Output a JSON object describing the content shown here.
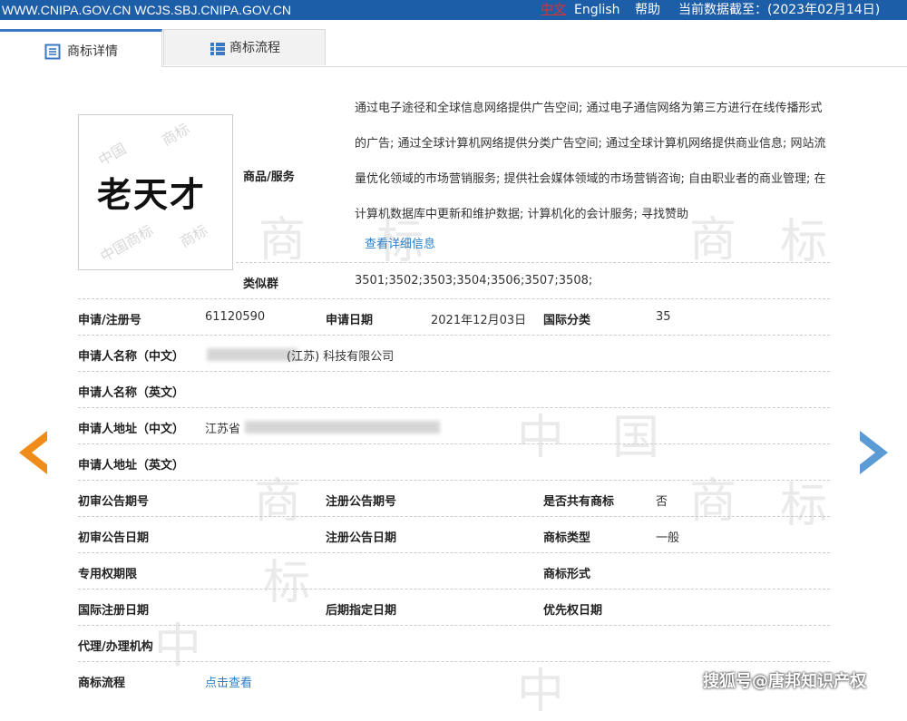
{
  "topbar": {
    "sites": "WWW.CNIPA.GOV.CN WCJS.SBJ.CNIPA.GOV.CN",
    "lang_cn": "中文",
    "lang_en": "English",
    "help": "帮助",
    "data_date": "当前数据截至：(2023年02月14日)"
  },
  "tabs": [
    {
      "label": "商标详情",
      "icon": "document-list-icon",
      "active": true
    },
    {
      "label": "商标流程",
      "icon": "flow-list-icon",
      "active": false
    }
  ],
  "trademark": {
    "logo_text": "老天才",
    "goods_label": "商品/服务",
    "goods_text": "通过电子途径和全球信息网络提供广告空间; 通过电子通信网络为第三方进行在线传播形式的广告; 通过全球计算机网络提供分类广告空间; 通过全球计算机网络提供商业信息; 网站流量优化领域的市场营销服务; 提供社会媒体领域的市场营销咨询; 自由职业者的商业管理; 在计算机数据库中更新和维护数据; 计算机化的会计服务; 寻找赞助",
    "view_detail": "查看详细信息",
    "similar_group_label": "类似群",
    "similar_group_value": "3501;3502;3503;3504;3506;3507;3508;"
  },
  "details": {
    "app_no_label": "申请/注册号",
    "app_no": "61120590",
    "app_date_label": "申请日期",
    "app_date": "2021年12月03日",
    "intl_class_label": "国际分类",
    "intl_class": "35",
    "applicant_cn_label": "申请人名称（中文）",
    "applicant_cn_visible": "(江苏) 科技有限公司",
    "applicant_en_label": "申请人名称（英文）",
    "address_cn_label": "申请人地址（中文）",
    "address_cn_visible": "江苏省",
    "address_en_label": "申请人地址（英文）",
    "prelim_no_label": "初审公告期号",
    "reg_no_label": "注册公告期号",
    "shared_label": "是否共有商标",
    "shared_value": "否",
    "prelim_date_label": "初审公告日期",
    "reg_date_label": "注册公告日期",
    "type_label": "商标类型",
    "type_value": "一般",
    "exclusive_label": "专用权期限",
    "form_label": "商标形式",
    "intl_reg_date_label": "国际注册日期",
    "later_date_label": "后期指定日期",
    "priority_date_label": "优先权日期",
    "agent_label": "代理/办理机构",
    "flow_label": "商标流程",
    "flow_link": "点击查看"
  },
  "footer_watermark": "搜狐号@唐邦知识产权",
  "colors": {
    "topbar": "#1d5ea8",
    "link": "#2a7fc9",
    "arrow_left": "#f08c1a",
    "arrow_right": "#5b9bd5"
  }
}
